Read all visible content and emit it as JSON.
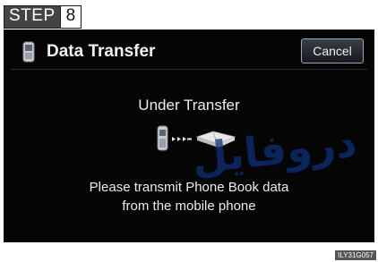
{
  "step": {
    "word": "STEP",
    "number": "8"
  },
  "header": {
    "title": "Data Transfer",
    "cancel_label": "Cancel"
  },
  "main": {
    "status": "Under Transfer",
    "message_line1": "Please transmit Phone Book data",
    "message_line2": "from the mobile phone"
  },
  "watermark_text": "دروفايل",
  "image_code": "ILY31G057",
  "icons": {
    "title_icon": "mobile-phone-icon",
    "transfer": [
      "mobile-phone-icon",
      "transfer-arrows-icon",
      "phone-book-icon"
    ]
  },
  "colors": {
    "screen_bg": "#050505",
    "text": "#ededed",
    "button_border": "#9aa7b8",
    "watermark": "#0d2f78"
  }
}
